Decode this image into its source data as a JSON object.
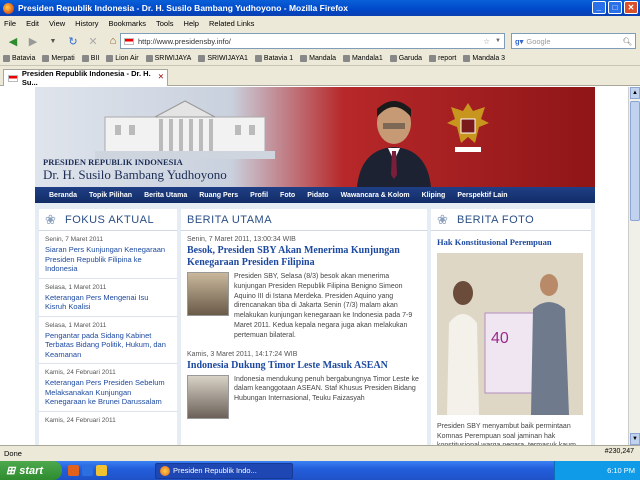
{
  "window": {
    "title": "Presiden Republik Indonesia - Dr. H. Susilo Bambang Yudhoyono - Mozilla Firefox"
  },
  "menubar": [
    "File",
    "Edit",
    "View",
    "History",
    "Bookmarks",
    "Tools",
    "Help",
    "Related Links"
  ],
  "navbar": {
    "url": "http://www.presidensby.info/",
    "search_placeholder": "Google"
  },
  "bookmarks": [
    "Batavia",
    "Merpati",
    "BII",
    "Lion Air",
    "SRIWIJAYA",
    "SRIWIJAYA1",
    "Batavia 1",
    "Mandala",
    "Mandala1",
    "Garuda",
    "report",
    "Mandala 3"
  ],
  "tab": {
    "label": "Presiden Republik Indonesia - Dr. H. Su..."
  },
  "banner": {
    "line1": "PRESIDEN REPUBLIK INDONESIA",
    "line2": "Dr. H. Susilo Bambang Yudhoyono"
  },
  "navmenu": [
    "Beranda",
    "Topik Pilihan",
    "Berita Utama",
    "Ruang Pers",
    "Profil",
    "Foto",
    "Pidato",
    "Wawancara & Kolom",
    "Kliping",
    "Perspektif Lain"
  ],
  "fokus": {
    "heading": "FOKUS AKTUAL",
    "items": [
      {
        "date": "Senin, 7 Maret 2011",
        "text": "Siaran Pers Kunjungan Kenegaraan Presiden Republik Filipina ke Indonesia"
      },
      {
        "date": "Selasa, 1 Maret 2011",
        "text": "Keterangan Pers Mengenai Isu Kisruh Koalisi"
      },
      {
        "date": "Selasa, 1 Maret 2011",
        "text": "Pengantar pada Sidang Kabinet Terbatas Bidang Politik, Hukum, dan Keamanan"
      },
      {
        "date": "Kamis, 24 Februari 2011",
        "text": "Keterangan Pers Presiden Sebelum Melaksanakan Kunjungan Kenegaraan ke Brunei Darussalam"
      },
      {
        "date": "Kamis, 24 Februari 2011",
        "text": ""
      }
    ]
  },
  "berita": {
    "heading": "BERITA UTAMA",
    "articles": [
      {
        "date": "Senin, 7 Maret 2011, 13:00:34 WIB",
        "title": "Besok, Presiden SBY Akan Menerima Kunjungan Kenegaraan Presiden Filipina",
        "body": "Presiden SBY, Selasa (8/3) besok akan menerima kunjungan Presiden Republik Filipina Benigno Simeon Aquino III di Istana Merdeka. Presiden Aquino yang direncanakan tiba di Jakarta Senin (7/3) malam akan melakukan kunjungan kenegaraan ke Indonesia pada 7-9 Maret 2011. Kedua kepala negara juga akan melakukan pertemuan bilateral."
      },
      {
        "date": "Kamis, 3 Maret 2011, 14:17:24 WIB",
        "title": "Indonesia Dukung Timor Leste Masuk ASEAN",
        "body": "Indonesia mendukung penuh bergabungnya Timor Leste ke dalam keanggotaan ASEAN. Staf Khusus Presiden Bidang Hubungan Internasional, Teuku Faizasyah"
      }
    ]
  },
  "foto": {
    "heading": "BERITA FOTO",
    "title": "Hak Konstitusional Perempuan",
    "caption": "Presiden SBY menyambut baik permintaan Komnas Perempuan soal jaminan hak konstitusional warga negara, termasuk kaum perempuan, atas"
  },
  "status": {
    "text": "Done",
    "tray_time": "6:10 PM",
    "counter": "#230,247"
  },
  "taskbar": {
    "start": "start",
    "task": "Presiden Republik Indo..."
  }
}
